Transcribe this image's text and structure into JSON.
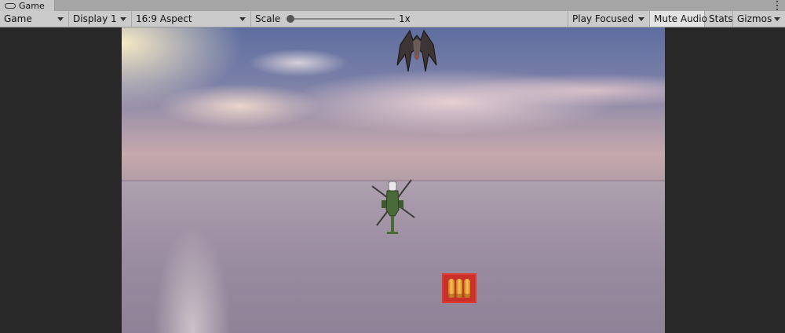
{
  "tab": {
    "label": "Game",
    "icon": "gamepad-icon"
  },
  "toolbar": {
    "view_mode": "Game",
    "display": "Display 1",
    "aspect": "16:9 Aspect",
    "scale_label": "Scale",
    "scale_value": "1x",
    "scale_fraction": 0.0,
    "play_mode": "Play Focused",
    "mute_audio": "Mute Audio",
    "stats": "Stats",
    "gizmos": "Gizmos"
  },
  "game": {
    "enemy": "spaceship-icon",
    "player": "helicopter-icon",
    "pickup": "ammo-pickup-icon"
  },
  "colors": {
    "toolbar_bg": "#cbcbcb",
    "editor_bg": "#282828",
    "pickup_red": "#c9302a"
  }
}
